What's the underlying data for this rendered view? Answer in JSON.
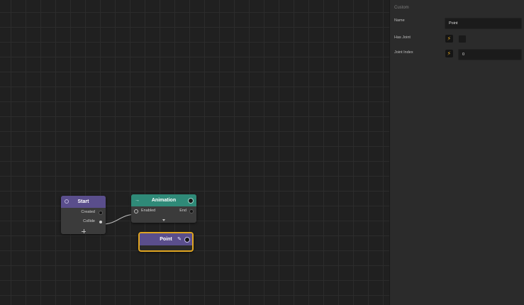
{
  "colors": {
    "canvas_bg": "#202020",
    "grid_line": "#2c2c2c",
    "inspector_bg": "#2b2b2b",
    "start_header": "#5a4e8c",
    "animation_header": "#2f8a78",
    "point_header": "#5a4e8c",
    "selection_outline": "#e0a521",
    "toggle_accent": "#e0a521",
    "wire": "#bdbdbd"
  },
  "nodes": {
    "start": {
      "title": "Start",
      "header_icon": "circle-icon",
      "outputs": [
        "Created",
        "Collide"
      ],
      "footer_icon": "plus-icon"
    },
    "animation": {
      "title": "Animation",
      "header_icon": "arrow-icon",
      "inputs": [
        "Enabled"
      ],
      "outputs": [
        "End"
      ],
      "expand_icon": "chevron-down-icon"
    },
    "point": {
      "title": "Point",
      "header_icon": "pencil-icon",
      "selected": true
    }
  },
  "inspector": {
    "section_title": "Custom",
    "fields": {
      "name": {
        "label": "Name",
        "value": "Point"
      },
      "has_joint": {
        "label": "Has Joint",
        "toggle_icon": "bolt-icon",
        "checked": false
      },
      "joint_index": {
        "label": "Joint Index",
        "toggle_icon": "bolt-icon",
        "value": "0"
      }
    }
  }
}
